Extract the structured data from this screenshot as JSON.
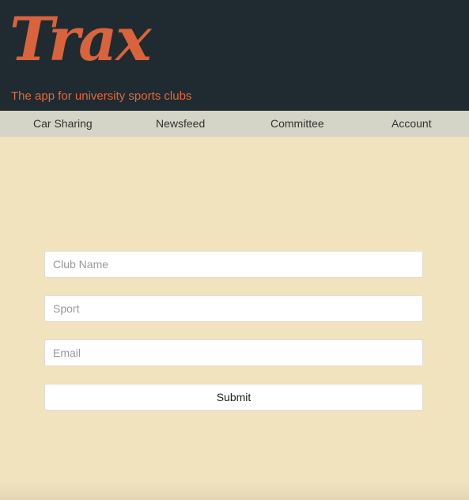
{
  "header": {
    "logo_text": "Trax",
    "tagline": "The app for university sports clubs"
  },
  "nav": {
    "items": [
      {
        "label": "Car Sharing"
      },
      {
        "label": "Newsfeed"
      },
      {
        "label": "Committee"
      },
      {
        "label": "Account"
      }
    ]
  },
  "form": {
    "club_name": {
      "value": "",
      "placeholder": "Club Name"
    },
    "sport": {
      "value": "",
      "placeholder": "Sport"
    },
    "email": {
      "value": "",
      "placeholder": "Email"
    },
    "submit_label": "Submit"
  },
  "colors": {
    "header_bg": "#1f2b30",
    "brand_orange": "#d8633d",
    "nav_bg": "#d4d5c7",
    "page_bg": "#f2e3bf"
  }
}
